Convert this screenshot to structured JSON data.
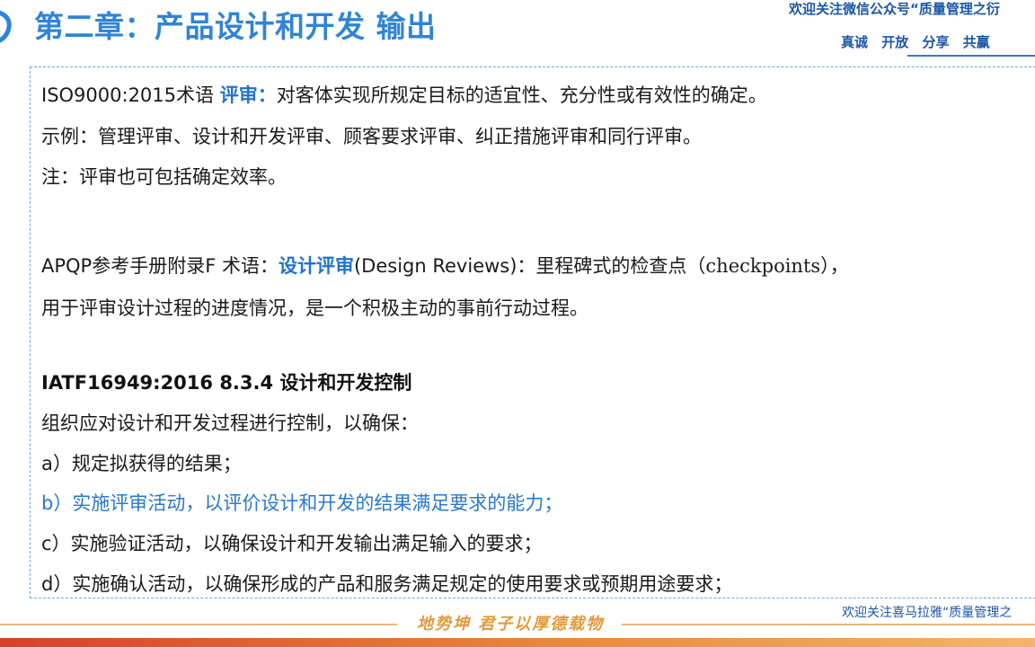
{
  "header": {
    "title": "第二章：产品设计和开发 输出",
    "wechat_note": "欢迎关注微信公众号“质量管理之衍",
    "slogan": "真诚 开放 分享 共赢"
  },
  "content": {
    "line1": {
      "prefix": "ISO9000:2015术语 ",
      "term": "评审：",
      "text": "对客体实现所规定目标的适宜性、充分性或有效性的确定。"
    },
    "line2": "示例：管理评审、设计和开发评审、顾客要求评审、纠正措施评审和同行评审。",
    "line3": "注：评审也可包括确定效率。",
    "line4": {
      "prefix": "APQP参考手册附录F  术语：",
      "term": "设计评审",
      "middle": "(Design Reviews)：里程碑式的检查点（",
      "serif_term": "checkpoints",
      "suffix": "），"
    },
    "line5": "用于评审设计过程的进度情况，是一个积极主动的事前行动过程。",
    "line6": "IATF16949:2016  8.3.4 设计和开发控制",
    "line7": "组织应对设计和开发过程进行控制，以确保：",
    "item_a": "a）规定拟获得的结果；",
    "item_b": "b）实施评审活动，以评价设计和开发的结果满足要求的能力；",
    "item_c": "c）实施验证活动，以确保设计和开发输出满足输入的要求；",
    "item_d": "d）实施确认活动，以确保形成的产品和服务满足规定的使用要求或预期用途要求；"
  },
  "footer": {
    "motto": "地势坤 君子以厚德载物",
    "note": "欢迎关注喜马拉雅“质量管理之"
  },
  "colors": {
    "title": "#2f84d6",
    "highlight": "#1f73d0",
    "footer_band": "#d7402a",
    "motto": "#e29a3c"
  }
}
